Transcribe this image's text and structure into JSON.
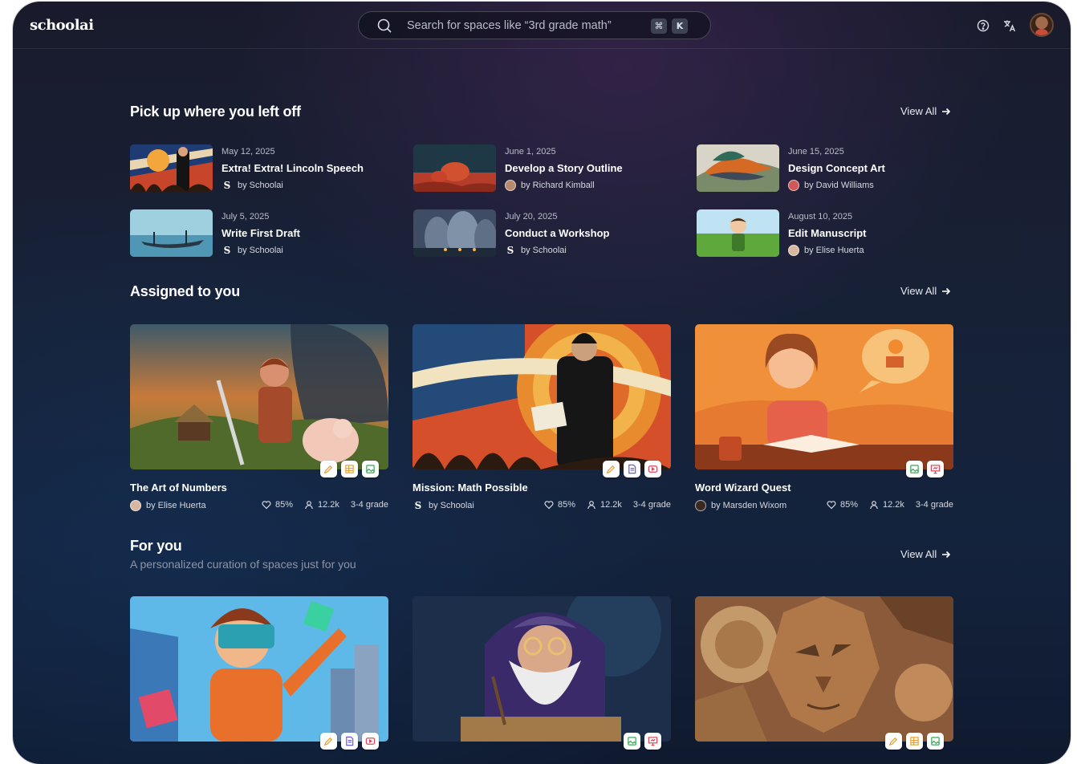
{
  "brand": {
    "logo": "schoolai"
  },
  "search": {
    "placeholder": "Search for spaces like “3rd grade math”",
    "key1": "⌘",
    "key2": "K"
  },
  "topbar": {
    "icons": [
      "help-icon",
      "translate-icon"
    ],
    "avatar": "user-avatar"
  },
  "sections": {
    "recent": {
      "title": "Pick up where you left off",
      "view_all": "View All"
    },
    "assigned": {
      "title": "Assigned to you",
      "view_all": "View All"
    },
    "for_you": {
      "title": "For you",
      "subtitle": "A personalized curation of spaces just for you",
      "view_all": "View All"
    }
  },
  "recent_items": [
    {
      "date": "May 12, 2025",
      "title": "Extra! Extra! Lincoln Speech",
      "author": "by Schoolai"
    },
    {
      "date": "June 1, 2025",
      "title": "Develop a Story Outline",
      "author": "by Richard Kimball"
    },
    {
      "date": "June 15, 2025",
      "title": "Design Concept Art",
      "author": "by David Williams"
    },
    {
      "date": "July 5, 2025",
      "title": "Write First Draft",
      "author": "by Schoolai"
    },
    {
      "date": "July 20, 2025",
      "title": "Conduct a Workshop",
      "author": "by Schoolai"
    },
    {
      "date": "August 10, 2025",
      "title": "Edit Manuscript",
      "author": "by Elise Huerta"
    }
  ],
  "assigned_cards": [
    {
      "title": "The Art of Numbers",
      "author": "by Elise Huerta",
      "likes": "85%",
      "users": "12.2k",
      "grade": "3-4 grade",
      "badges": [
        "pencil-icon",
        "grid-icon",
        "image-icon"
      ]
    },
    {
      "title": "Mission: Math Possible",
      "author": "by Schoolai",
      "likes": "85%",
      "users": "12.2k",
      "grade": "3-4 grade",
      "badges": [
        "pencil-icon",
        "document-icon",
        "video-icon"
      ]
    },
    {
      "title": "Word Wizard Quest",
      "author": "by Marsden Wixom",
      "likes": "85%",
      "users": "12.2k",
      "grade": "3-4 grade",
      "badges": [
        "image-icon",
        "presentation-icon"
      ]
    }
  ],
  "for_you_cards": [
    {
      "badges": [
        "pencil-icon",
        "document-icon",
        "video-icon"
      ]
    },
    {
      "badges": [
        "image-icon",
        "presentation-icon"
      ]
    },
    {
      "badges": [
        "pencil-icon",
        "grid-icon",
        "image-icon"
      ]
    }
  ],
  "colors": {
    "badge_pencil": "#e8a23a",
    "badge_grid": "#e8a23a",
    "badge_image": "#3aa55a",
    "badge_doc": "#6a5ae0",
    "badge_video": "#e0455a",
    "badge_present": "#e0455a"
  }
}
